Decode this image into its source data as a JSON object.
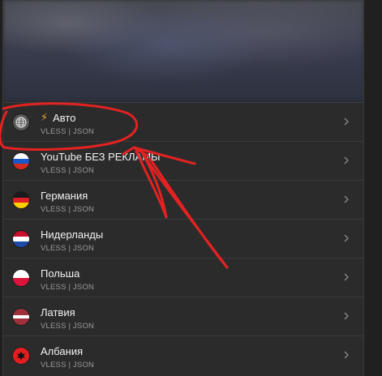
{
  "servers": [
    {
      "name": "Авто",
      "subtitle": "VLESS | JSON",
      "flag_icon": "globe-icon",
      "prefix_icon": "lightning-icon"
    },
    {
      "name": "YouTube БЕЗ РЕКЛАМЫ",
      "subtitle": "VLESS | JSON",
      "flag_icon": "flag-russia-icon"
    },
    {
      "name": "Германия",
      "subtitle": "VLESS | JSON",
      "flag_icon": "flag-germany-icon"
    },
    {
      "name": "Нидерланды",
      "subtitle": "VLESS | JSON",
      "flag_icon": "flag-netherlands-icon"
    },
    {
      "name": "Польша",
      "subtitle": "VLESS | JSON",
      "flag_icon": "flag-poland-icon"
    },
    {
      "name": "Латвия",
      "subtitle": "VLESS | JSON",
      "flag_icon": "flag-latvia-icon"
    },
    {
      "name": "Албания",
      "subtitle": "VLESS | JSON",
      "flag_icon": "flag-albania-icon"
    }
  ],
  "colors": {
    "panel_bg": "#2b2b2b",
    "text_primary": "#f2f2f2",
    "text_secondary": "#9a9a9a",
    "accent_bolt": "#f0a430",
    "annotation_red": "#e32222"
  }
}
